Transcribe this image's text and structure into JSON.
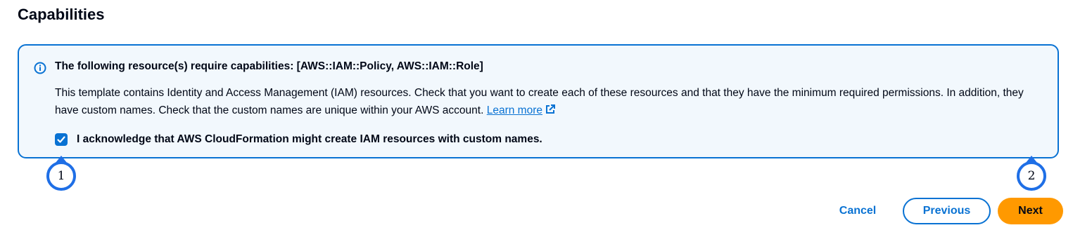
{
  "section": {
    "title": "Capabilities"
  },
  "alert": {
    "icon": "info-icon",
    "heading": "The following resource(s) require capabilities: [AWS::IAM::Policy, AWS::IAM::Role]",
    "body": "This template contains Identity and Access Management (IAM) resources. Check that you want to create each of these resources and that they have the minimum required permissions. In addition, they have custom names. Check that the custom names are unique within your AWS account.",
    "link_label": "Learn more",
    "link_icon": "external-link-icon"
  },
  "acknowledge": {
    "checked": true,
    "label": "I acknowledge that AWS CloudFormation might create IAM resources with custom names."
  },
  "callouts": {
    "first": "1",
    "second": "2"
  },
  "actions": {
    "cancel_label": "Cancel",
    "previous_label": "Previous",
    "next_label": "Next"
  },
  "colors": {
    "accent": "#0972d3",
    "primary_button": "#ff9900",
    "alert_background": "#f2f8fd",
    "callout_ring": "#1f6fe6"
  }
}
